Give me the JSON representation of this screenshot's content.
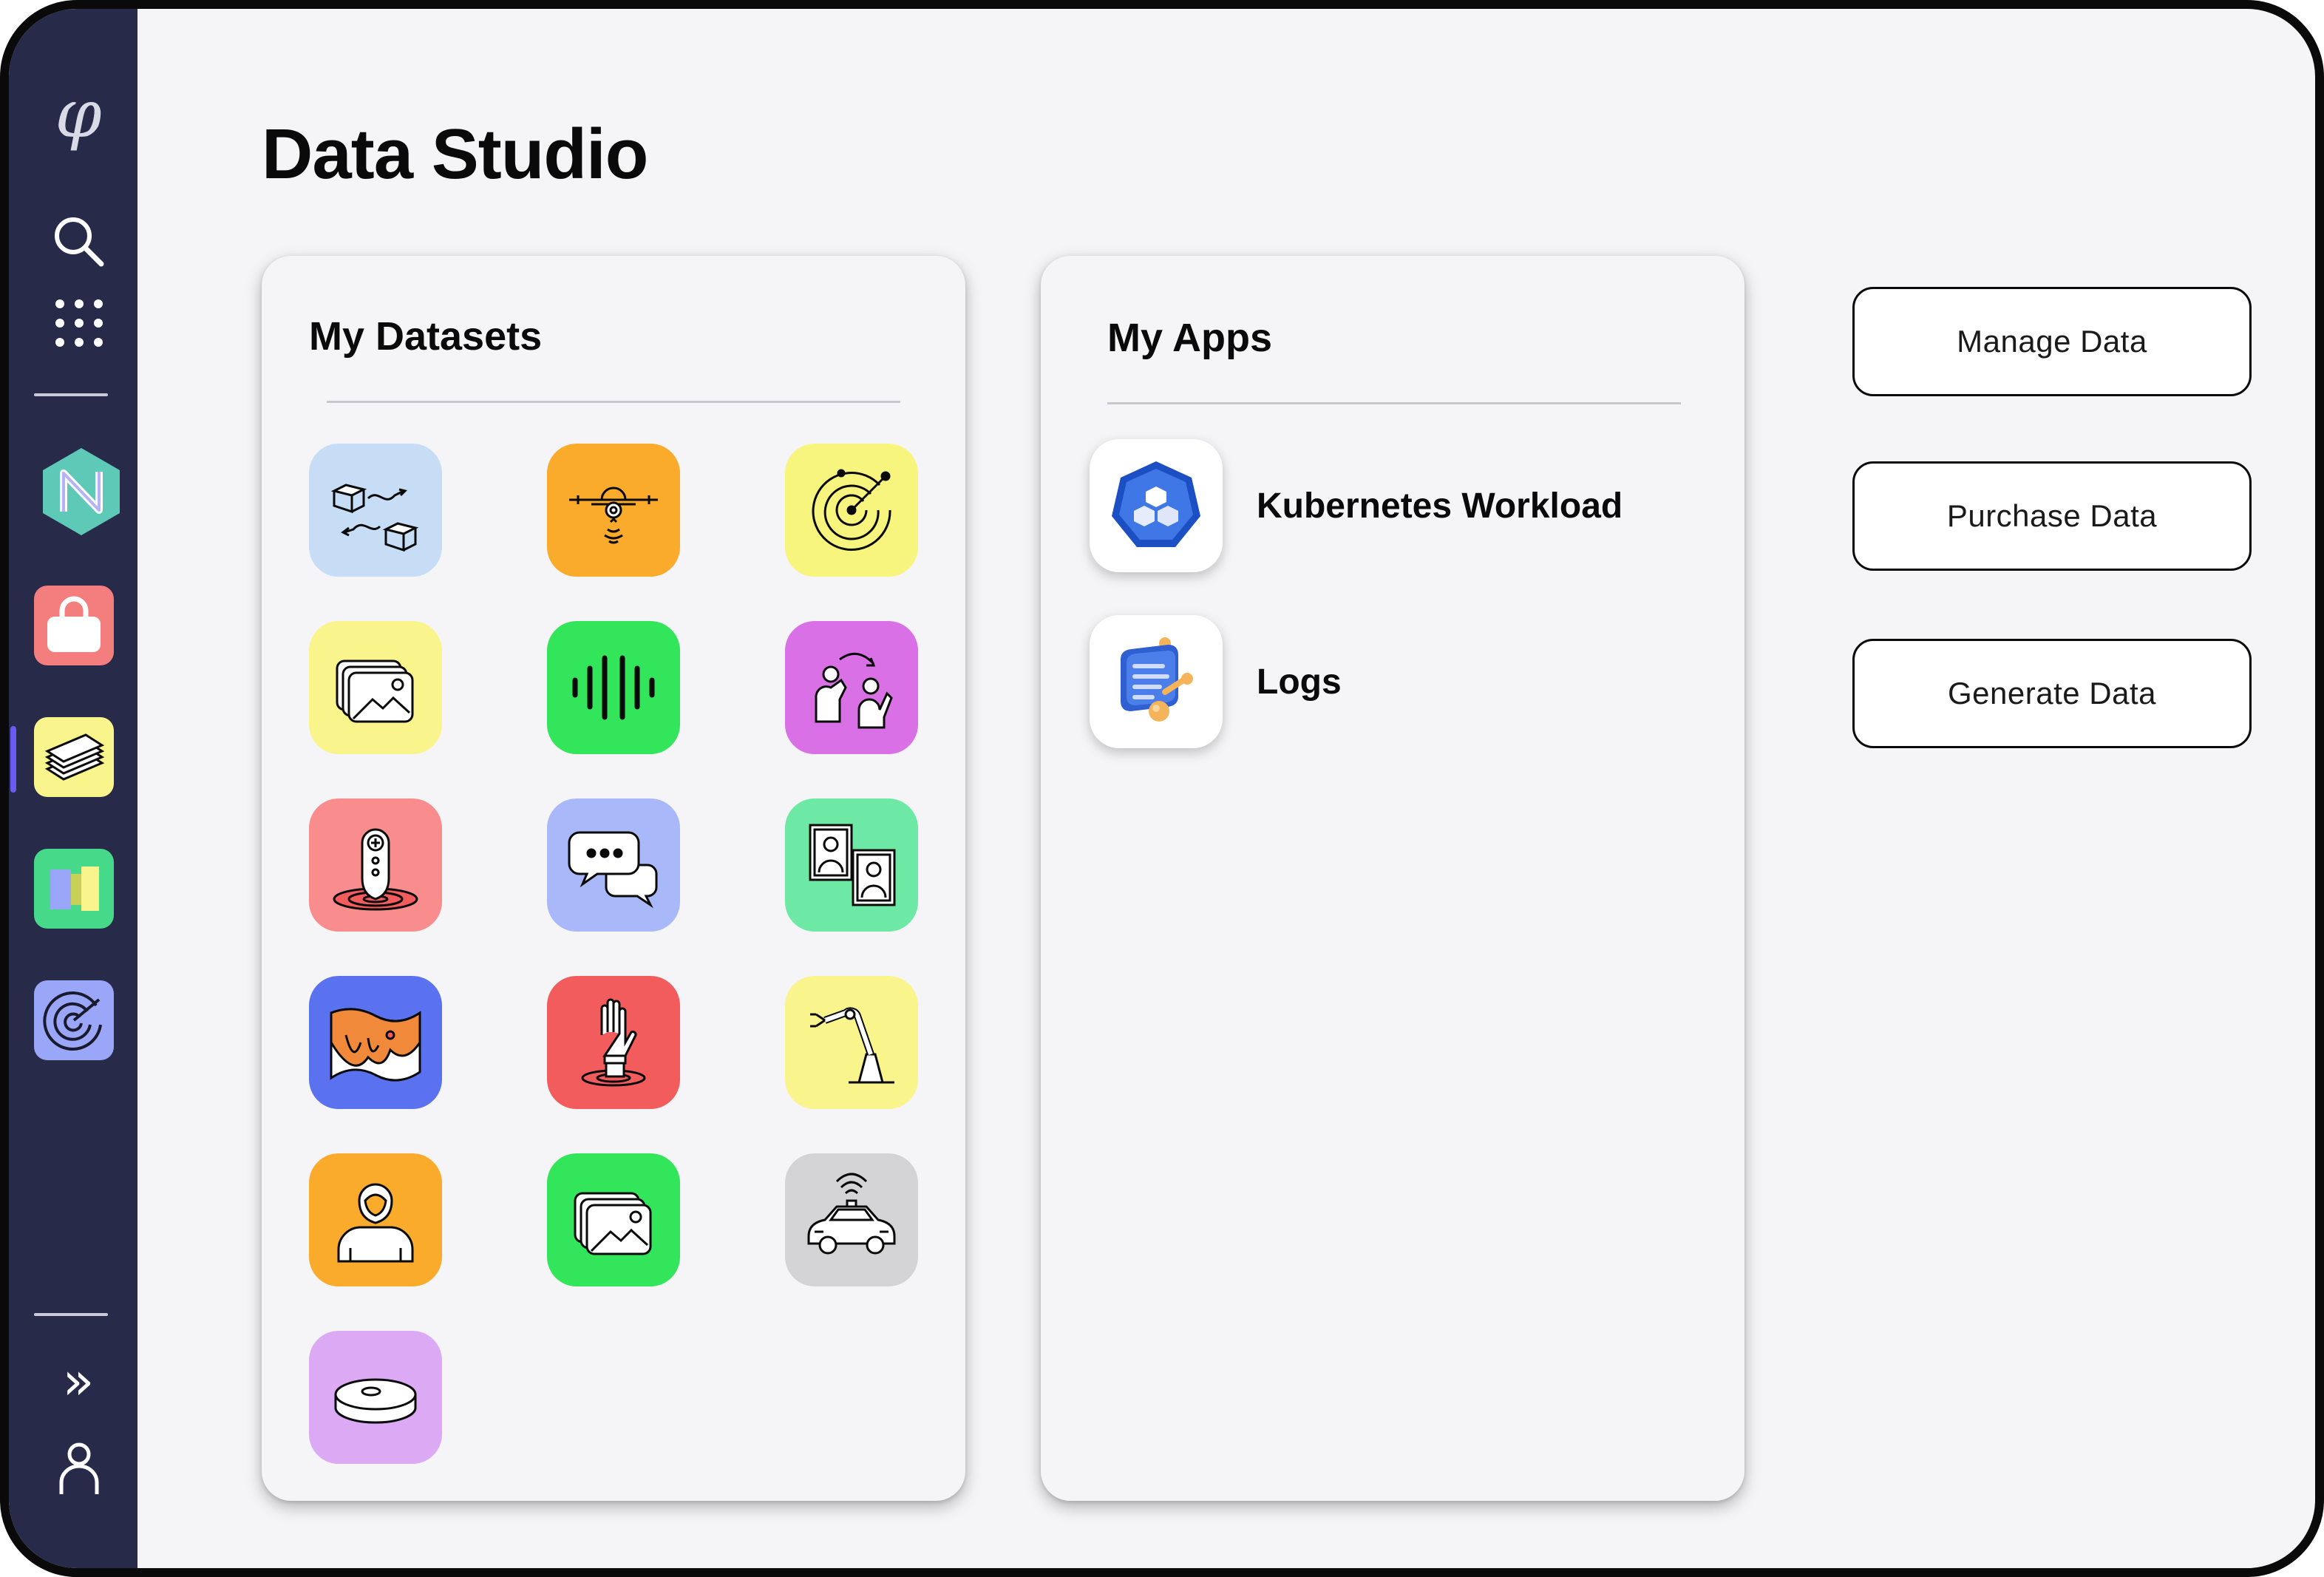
{
  "page": {
    "title": "Data Studio"
  },
  "sidebar": {
    "logo_glyph": "φ",
    "items": [
      {
        "icon": "search-icon"
      },
      {
        "icon": "apps-grid-icon"
      },
      {
        "icon": "nft-hexagon-icon",
        "color": "#5fc9b8"
      },
      {
        "icon": "shopping-bag-icon",
        "color": "#f47e7e"
      },
      {
        "icon": "datasets-stack-icon",
        "color": "#f9f48c",
        "active": true
      },
      {
        "icon": "panels-icon",
        "color": "#46d98a"
      },
      {
        "icon": "radar-icon",
        "color": "#9aa6f7"
      }
    ],
    "expand_glyph": "»",
    "bottom_icons": [
      "expand-icon",
      "user-icon"
    ]
  },
  "datasets": {
    "title": "My Datasets",
    "tiles": [
      {
        "icon": "data-transfer-icon",
        "color": "#c7dcf5"
      },
      {
        "icon": "drone-icon",
        "color": "#fbab2b"
      },
      {
        "icon": "radar-scan-icon",
        "color": "#f7f57e"
      },
      {
        "icon": "image-stack-icon",
        "color": "#f9f48c"
      },
      {
        "icon": "audio-wave-icon",
        "color": "#33e55a"
      },
      {
        "icon": "people-interaction-icon",
        "color": "#d970e6"
      },
      {
        "icon": "location-pin-icon",
        "color": "#f98d8d"
      },
      {
        "icon": "chat-bubbles-icon",
        "color": "#a9b8f8"
      },
      {
        "icon": "portrait-photos-icon",
        "color": "#6ee9a5"
      },
      {
        "icon": "terrain-map-icon",
        "color": "#5a72f0"
      },
      {
        "icon": "robot-hand-icon",
        "color": "#f25c5c"
      },
      {
        "icon": "robot-arm-icon",
        "color": "#f9f48c"
      },
      {
        "icon": "person-avatar-icon",
        "color": "#fbab2b"
      },
      {
        "icon": "image-gallery-icon",
        "color": "#33e55a"
      },
      {
        "icon": "autonomous-car-icon",
        "color": "#d4d4d6"
      },
      {
        "icon": "robot-vacuum-icon",
        "color": "#dcaaf5"
      }
    ]
  },
  "apps": {
    "title": "My Apps",
    "items": [
      {
        "label": "Kubernetes Workload",
        "icon": "kubernetes-icon"
      },
      {
        "label": "Logs",
        "icon": "logs-icon"
      }
    ]
  },
  "actions": {
    "manage": "Manage Data",
    "purchase": "Purchase Data",
    "generate": "Generate Data"
  }
}
